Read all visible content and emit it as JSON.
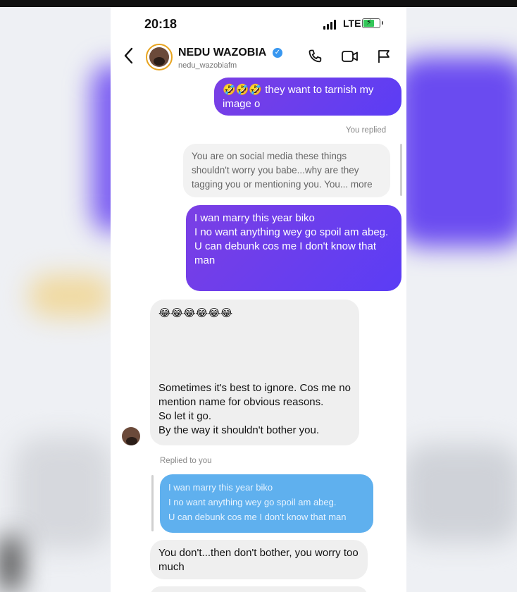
{
  "status": {
    "time": "20:18",
    "network": "LTE"
  },
  "header": {
    "name": "NEDU WAZOBIA",
    "handle": "nedu_wazobiafm",
    "icons": [
      "back-chevron-icon",
      "phone-icon",
      "video-icon",
      "flag-icon"
    ]
  },
  "messages": {
    "m1": {
      "emoji": "🤣🤣🤣",
      "text": "they want to tarnish my image o"
    },
    "you_replied": "You replied",
    "quoted1": "You are on social media these things shouldn't worry you babe...why are they tagging you or mentioning you. You... more",
    "m2": [
      "I wan marry this year biko",
      "I no want anything wey go spoil am abeg.",
      "U can debunk cos me I don't know that man"
    ],
    "m3": {
      "emoji": "😂😂😂😂😂😂",
      "lines": [
        "Sometimes it's best to ignore. Cos me no mention name for obvious reasons.",
        "So let it go.",
        "By the way it shouldn't bother you."
      ]
    },
    "replied_to_you": "Replied to you",
    "quoted2": [
      "I wan marry this year biko",
      "I no want anything wey go spoil am abeg.",
      "U can debunk cos me I don't know that man"
    ],
    "m4": "You don't...then don't bother, you worry too much"
  },
  "colors": {
    "outgoing_start": "#7b3fe4",
    "outgoing_end": "#5b3df5",
    "incoming": "#efefef",
    "quoted_blue": "#5fb0ee",
    "verified": "#3897f0"
  }
}
